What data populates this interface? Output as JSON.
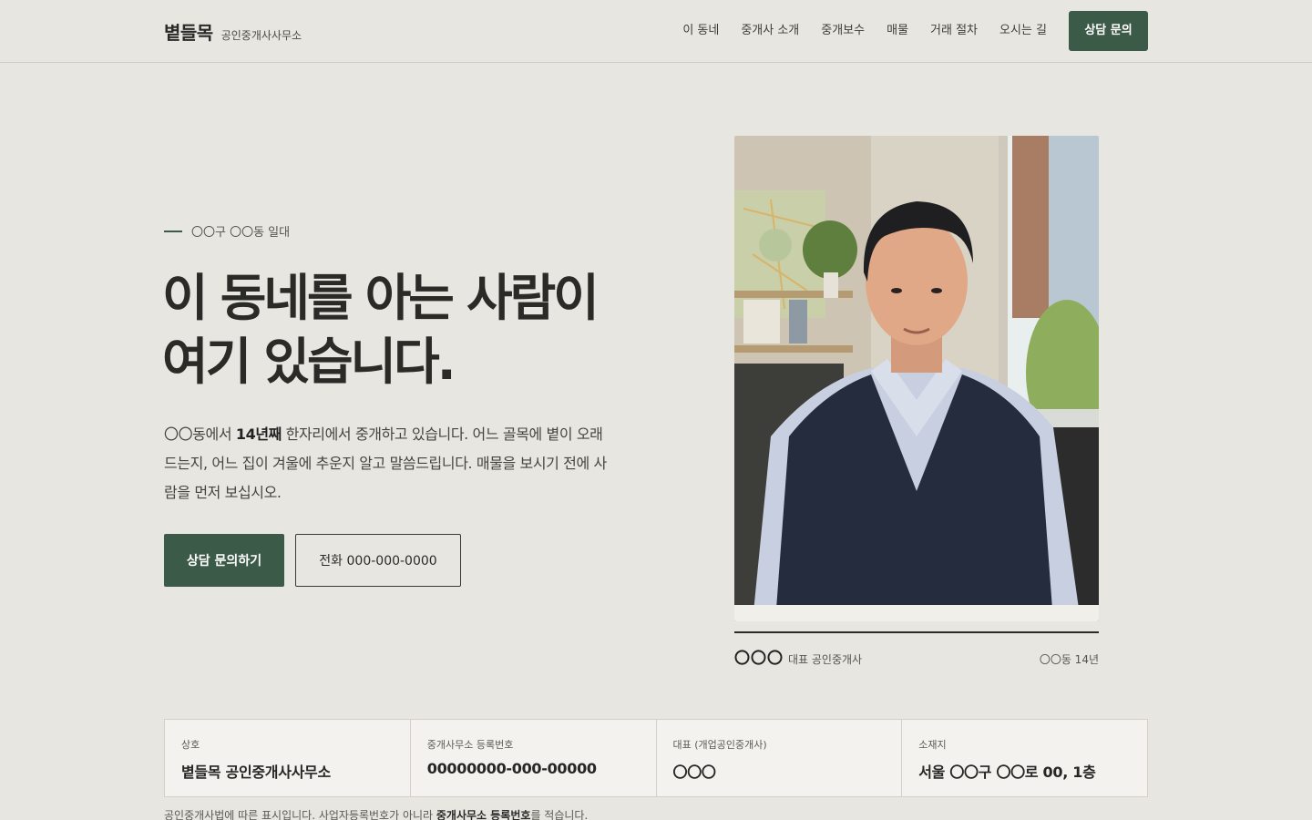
{
  "header": {
    "brand_name": "볕들목",
    "brand_sub": "공인중개사사무소",
    "nav": [
      "이 동네",
      "중개사 소개",
      "중개보수",
      "매물",
      "거래 절차",
      "오시는 길"
    ],
    "cta": "상담 문의"
  },
  "hero": {
    "eyebrow": "〇〇구 〇〇동 일대",
    "headline_line1": "이 동네를 아는 사람이",
    "headline_line2": "여기 있습니다.",
    "desc_pre": "〇〇동에서 ",
    "desc_bold": "14년째",
    "desc_post": " 한자리에서 중개하고 있습니다. 어느 골목에 볕이 오래 드는지, 어느 집이 겨울에 추운지 알고 말씀드립니다. 매물을 보시기 전에 사람을 먼저 보십시오.",
    "primary_button": "상담 문의하기",
    "secondary_button": "전화 000-000-0000"
  },
  "portrait": {
    "name": "〇〇〇",
    "role": "대표 공인중개사",
    "tenure": "〇〇동 14년"
  },
  "info": [
    {
      "label": "상호",
      "value": "볕들목 공인중개사사무소"
    },
    {
      "label": "중개사무소 등록번호",
      "value": "00000000-000-00000"
    },
    {
      "label": "대표 (개업공인중개사)",
      "value": "〇〇〇"
    },
    {
      "label": "소재지",
      "value": "서울 〇〇구 〇〇로 00, 1층"
    }
  ],
  "footnote": {
    "pre": "공인중개사법에 따른 표시입니다. 사업자등록번호가 아니라 ",
    "bold": "중개사무소 등록번호",
    "post": "를 적습니다."
  },
  "colors": {
    "background": "#e8e6e1",
    "accent": "#3b5a47"
  }
}
